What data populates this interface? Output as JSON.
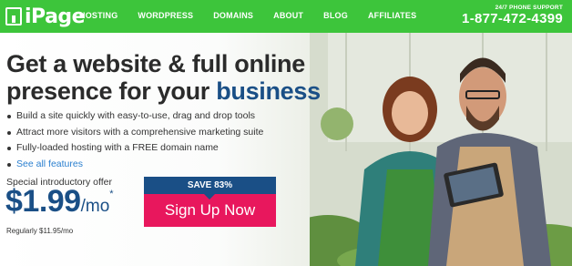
{
  "header": {
    "logo_text": "iPage",
    "nav": [
      "HOSTING",
      "WORDPRESS",
      "DOMAINS",
      "ABOUT",
      "BLOG",
      "AFFILIATES"
    ],
    "phone_label": "24/7 PHONE SUPPORT",
    "phone_number": "1-877-472-4399"
  },
  "hero": {
    "headline_line1": "Get a website & full online",
    "headline_line2_prefix": "presence for your ",
    "headline_accent": "business",
    "features": [
      "Build a site quickly with easy-to-use, drag and drop tools",
      "Attract more visitors with a comprehensive marketing suite",
      "Fully-loaded hosting with a FREE domain name"
    ],
    "see_all": "See all features",
    "offer_label": "Special introductory offer",
    "price": "$1.99",
    "per": "/mo",
    "asterisk": "*",
    "regular": "Regularly $11.95/mo",
    "save": "SAVE 83%",
    "cta": "Sign Up Now"
  },
  "colors": {
    "header_green": "#3dc53b",
    "brand_blue": "#1a4f86",
    "cta_pink": "#e8175d",
    "link_blue": "#2a7fcf"
  }
}
